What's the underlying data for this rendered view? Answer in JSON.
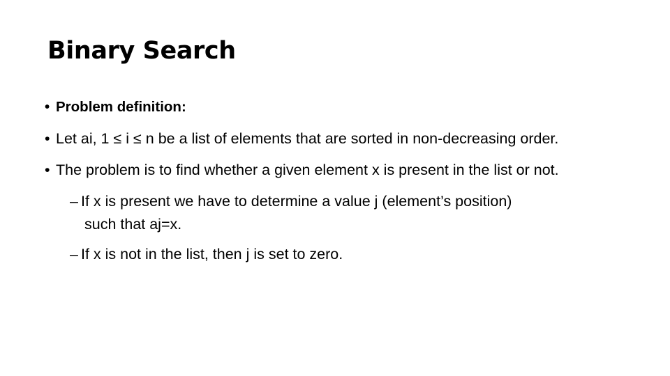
{
  "slide": {
    "title": "Binary Search",
    "background_color": "#ffffff",
    "text_color": "#000000",
    "bullets": {
      "bullet_glyph": "•",
      "dash_glyph": "–"
    },
    "body": {
      "problem_definition_heading": "Problem definition:",
      "let_line": "Let ai, 1 ≤ i ≤ n be a list of elements that are sorted in non-decreasing order.",
      "problem_line": "The problem is to find whether a given element x is present in the list or not.",
      "sub_present": "If x is present we have to determine a value j (element’s position)",
      "sub_present_cont": "such that aj=x.",
      "sub_absent": "If x is not in the list, then j is set to zero."
    }
  }
}
